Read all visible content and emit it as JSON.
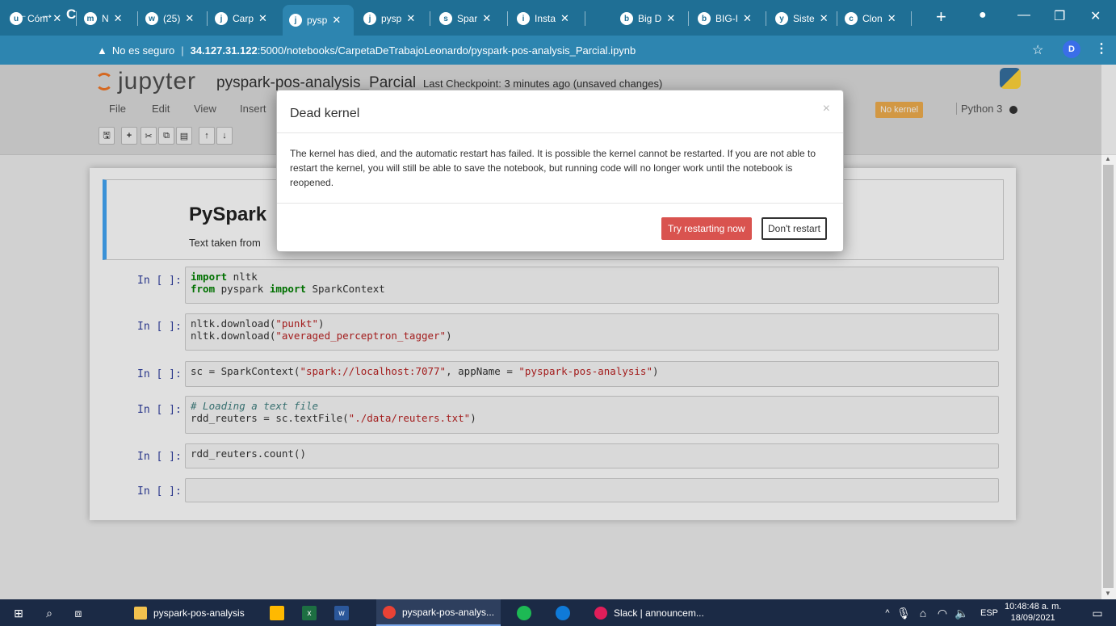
{
  "browser": {
    "tabs": [
      {
        "icon": "u",
        "title": "Cóm"
      },
      {
        "icon": "m",
        "title": "N"
      },
      {
        "icon": "w",
        "title": "(25)"
      },
      {
        "icon": "j",
        "title": "Carp"
      },
      {
        "icon": "j",
        "title": "pysp"
      },
      {
        "icon": "j",
        "title": "pysp"
      },
      {
        "icon": "s",
        "title": "Spar"
      },
      {
        "icon": "i",
        "title": "Insta"
      },
      {
        "icon": "b",
        "title": "Big D"
      },
      {
        "icon": "b",
        "title": "BIG-I"
      },
      {
        "icon": "y",
        "title": "Siste"
      },
      {
        "icon": "c",
        "title": "Clon"
      }
    ],
    "new_tab": "+",
    "address": {
      "security": "No es seguro",
      "host": "34.127.31.122",
      "path": ":5000/notebooks/CarpetaDeTrabajoLeonardo/pyspark-pos-analysis_Parcial.ipynb"
    },
    "profile_initial": "D"
  },
  "jupyter": {
    "logo_text": "jupyter",
    "notebook_title": "pyspark-pos-analysis_Parcial",
    "checkpoint": "Last Checkpoint: 3 minutes ago (unsaved changes)",
    "menu": [
      "File",
      "Edit",
      "View",
      "Insert"
    ],
    "kernel_status": "No kernel",
    "kernel_name": "Python 3"
  },
  "markdown_cell": {
    "heading": "PySpark",
    "text": "Text taken from"
  },
  "cells": [
    {
      "prompt": "In [ ]:"
    },
    {
      "prompt": "In [ ]:"
    },
    {
      "prompt": "In [ ]:"
    },
    {
      "prompt": "In [ ]:"
    },
    {
      "prompt": "In [ ]:"
    },
    {
      "prompt": "In [ ]:"
    }
  ],
  "code": {
    "c1": {
      "kw1": "import",
      "t1": " nltk",
      "kw2": "from",
      "t2": " pyspark ",
      "kw3": "import",
      "t3": " SparkContext"
    },
    "c2": {
      "a1": "nltk.download(",
      "s1": "\"punkt\"",
      "a2": ")",
      "b1": "nltk.download(",
      "s2": "\"averaged_perceptron_tagger\"",
      "b2": ")"
    },
    "c3": {
      "a1": "sc = SparkContext(",
      "s1": "\"spark://localhost:7077\"",
      "a2": ", appName = ",
      "s2": "\"pyspark-pos-analysis\"",
      "a3": ")"
    },
    "c4": {
      "comment": "# Loading a text file",
      "a1": "rdd_reuters = sc.textFile(",
      "s1": "\"./data/reuters.txt\"",
      "a2": ")"
    },
    "c5": {
      "a1": "rdd_reuters.count()"
    }
  },
  "modal": {
    "title": "Dead kernel",
    "close": "×",
    "body": "The kernel has died, and the automatic restart has failed. It is possible the kernel cannot be restarted. If you are not able to restart the kernel, you will still be able to save the notebook, but running code will no longer work until the notebook is reopened.",
    "restart_button": "Try restarting now",
    "dont_restart_button": "Don't restart"
  },
  "taskbar": {
    "apps": [
      {
        "label": "pyspark-pos-analysis",
        "color": "#f2c14e"
      },
      {
        "label": "pyspark-pos-analys...",
        "color": "#e94235"
      },
      {
        "label": "Slack | announcem...",
        "color": "#e01e5a"
      }
    ],
    "language": "ESP",
    "time": "10:48:48 a. m.",
    "date": "18/09/2021"
  }
}
